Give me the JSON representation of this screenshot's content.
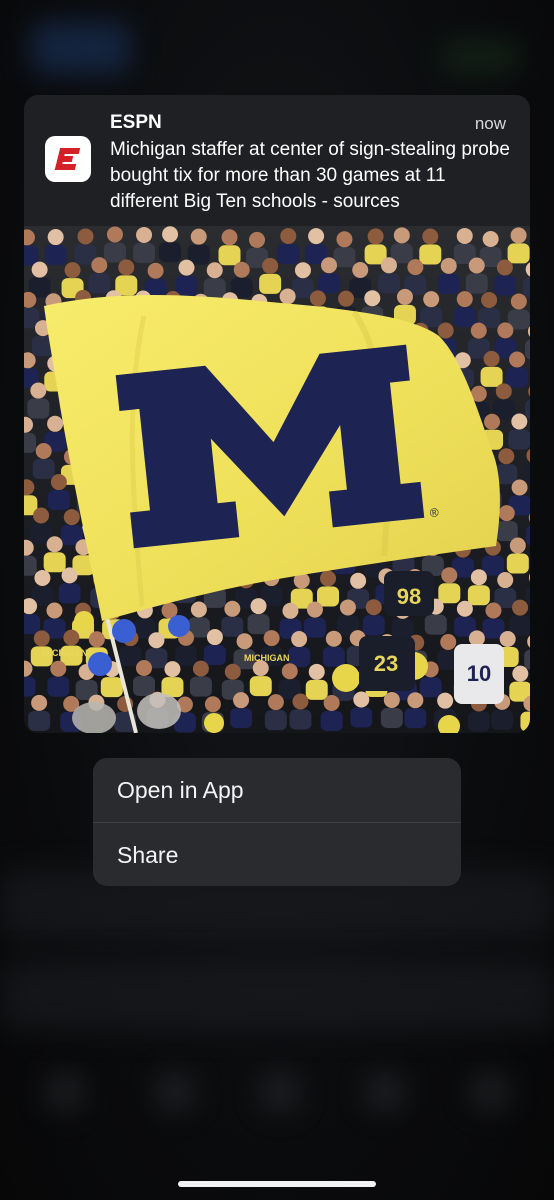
{
  "notification": {
    "app_name": "ESPN",
    "app_icon": "espn-e-logo",
    "timestamp": "now",
    "message": "Michigan staffer at center of sign-stealing probe bought tix for more than 30 games at 11 different Big Ten schools - sources",
    "image": {
      "flag_letter": "M",
      "flag_registered": "®",
      "jersey_numbers": [
        "98",
        "23",
        "10"
      ],
      "jersey_text": [
        "MICHIGAN",
        "MICHIGAN"
      ]
    }
  },
  "context_menu": {
    "items": [
      {
        "label": "Open in App"
      },
      {
        "label": "Share"
      }
    ]
  },
  "colors": {
    "espn_red": "#d42027",
    "michigan_maize": "#f2e35f",
    "michigan_blue": "#1d2353"
  }
}
